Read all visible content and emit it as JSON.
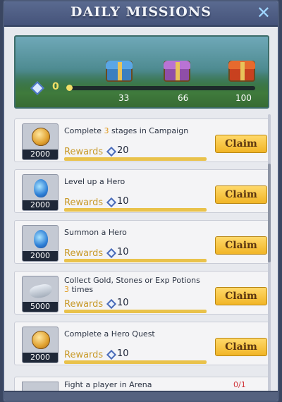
{
  "header": {
    "title": "DAILY MISSIONS",
    "close_icon": "close-icon"
  },
  "progress": {
    "points": "0",
    "fill_fraction": 0,
    "milestones": [
      "33",
      "66",
      "100"
    ],
    "chest_icons": [
      "blue-chest-icon",
      "purple-chest-icon",
      "gold-chest-icon"
    ]
  },
  "missions": [
    {
      "icon": "gold-coin-icon",
      "amount": "2000",
      "text_pre": "Complete ",
      "text_hl": "3",
      "text_post": " stages in Campaign",
      "rewards_label": "Rewards",
      "reward_value": "20",
      "button": "Claim"
    },
    {
      "icon": "exp-potion-icon",
      "amount": "2000",
      "text_pre": "Level up a Hero",
      "text_hl": "",
      "text_post": "",
      "rewards_label": "Rewards",
      "reward_value": "10",
      "button": "Claim"
    },
    {
      "icon": "exp-potion-icon",
      "amount": "2000",
      "text_pre": "Summon a Hero",
      "text_hl": "",
      "text_post": "",
      "rewards_label": "Rewards",
      "reward_value": "10",
      "button": "Claim"
    },
    {
      "icon": "stone-icon",
      "amount": "5000",
      "text_pre": "Collect Gold, Stones or Exp Potions ",
      "text_hl": "3",
      "text_post": " times",
      "rewards_label": "Rewards",
      "reward_value": "10",
      "button": "Claim"
    },
    {
      "icon": "gold-coin-icon",
      "amount": "2000",
      "text_pre": "Complete a Hero Quest",
      "text_hl": "",
      "text_post": "",
      "rewards_label": "Rewards",
      "reward_value": "10",
      "button": "Claim"
    }
  ],
  "partial_mission": {
    "text": "Fight a player in Arena",
    "count": "0/1"
  },
  "colors": {
    "header": "#4d5b82",
    "claim": "#f6c13a",
    "highlight": "#e0981a",
    "reward_bar": "#e9c24b"
  }
}
